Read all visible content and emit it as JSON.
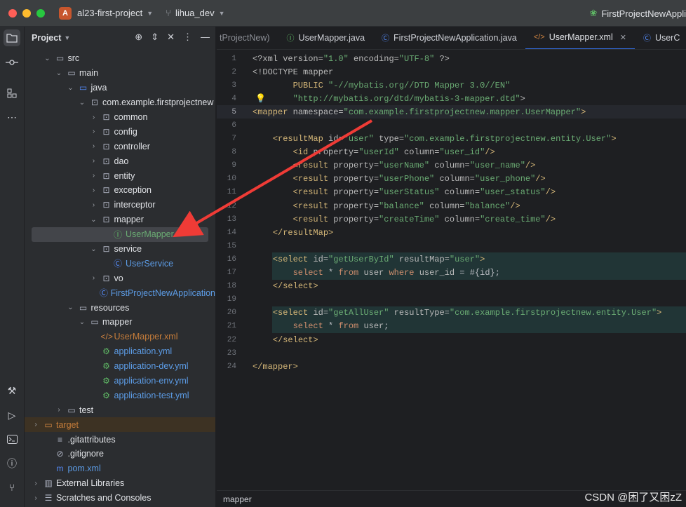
{
  "window": {
    "project_badge": "A",
    "project_name": "al23-first-project",
    "branch": "lihua_dev",
    "run_config": "FirstProjectNewAppli"
  },
  "project_panel": {
    "title": "Project",
    "tree": [
      {
        "label": "src",
        "type": "folder",
        "arrow": "open"
      },
      {
        "label": "main",
        "type": "folder",
        "arrow": "open"
      },
      {
        "label": "java",
        "type": "folder-src",
        "arrow": "open"
      },
      {
        "label": "com.example.firstprojectnew",
        "type": "package",
        "arrow": "open"
      },
      {
        "label": "common",
        "type": "package",
        "arrow": "closed"
      },
      {
        "label": "config",
        "type": "package",
        "arrow": "closed"
      },
      {
        "label": "controller",
        "type": "package",
        "arrow": "closed"
      },
      {
        "label": "dao",
        "type": "package",
        "arrow": "closed"
      },
      {
        "label": "entity",
        "type": "package",
        "arrow": "closed"
      },
      {
        "label": "exception",
        "type": "package",
        "arrow": "closed"
      },
      {
        "label": "interceptor",
        "type": "package",
        "arrow": "closed"
      },
      {
        "label": "mapper",
        "type": "package",
        "arrow": "open"
      },
      {
        "label": "UserMapper",
        "type": "interface",
        "arrow": "none",
        "selected": true
      },
      {
        "label": "service",
        "type": "package",
        "arrow": "open"
      },
      {
        "label": "UserService",
        "type": "class",
        "arrow": "none"
      },
      {
        "label": "vo",
        "type": "package",
        "arrow": "closed"
      },
      {
        "label": "FirstProjectNewApplication",
        "type": "spring-class",
        "arrow": "none"
      },
      {
        "label": "resources",
        "type": "folder-res",
        "arrow": "open"
      },
      {
        "label": "mapper",
        "type": "folder",
        "arrow": "open"
      },
      {
        "label": "UserMapper.xml",
        "type": "xml",
        "arrow": "none"
      },
      {
        "label": "application.yml",
        "type": "yml",
        "arrow": "none"
      },
      {
        "label": "application-dev.yml",
        "type": "yml",
        "arrow": "none"
      },
      {
        "label": "application-env.yml",
        "type": "yml",
        "arrow": "none"
      },
      {
        "label": "application-test.yml",
        "type": "yml",
        "arrow": "none"
      },
      {
        "label": "test",
        "type": "folder",
        "arrow": "closed"
      },
      {
        "label": "target",
        "type": "folder-excluded",
        "arrow": "closed"
      },
      {
        "label": ".gitattributes",
        "type": "text",
        "arrow": "none"
      },
      {
        "label": ".gitignore",
        "type": "ignore",
        "arrow": "none"
      },
      {
        "label": "pom.xml",
        "type": "maven",
        "arrow": "none"
      },
      {
        "label": "External Libraries",
        "type": "library",
        "arrow": "closed"
      },
      {
        "label": "Scratches and Consoles",
        "type": "scratch",
        "arrow": "closed"
      }
    ]
  },
  "tabs": [
    {
      "label": "tProjectNew)",
      "icon": "none"
    },
    {
      "label": "UserMapper.java",
      "icon": "interface-icon"
    },
    {
      "label": "FirstProjectNewApplication.java",
      "icon": "spring-class-icon"
    },
    {
      "label": "UserMapper.xml",
      "icon": "xml-icon",
      "active": true
    },
    {
      "label": "UserC",
      "icon": "class-icon"
    }
  ],
  "code_lines": [
    {
      "n": "1",
      "html": "<span class='a'>&lt;?xml version=</span><span class='s'>\"1.0\"</span><span class='a'> encoding=</span><span class='s'>\"UTF-8\"</span><span class='a'> ?&gt;</span>"
    },
    {
      "n": "2",
      "html": "<span class='a'>&lt;!DOCTYPE mapper</span>"
    },
    {
      "n": "3",
      "html": "        <span class='k'>PUBLIC</span> <span class='s'>\"-//mybatis.org//DTD Mapper 3.0//EN\"</span>"
    },
    {
      "n": "4",
      "html": "        <span class='s'>\"http://mybatis.org/dtd/mybatis-3-mapper.dtd\"</span><span class='a'>&gt;</span>"
    },
    {
      "n": "5",
      "html": "<span class='k'>&lt;mapper</span> <span class='a'>namespace=</span><span class='s'>\"com.example.firstprojectnew.mapper.UserMapper\"</span><span class='k'>&gt;</span>",
      "current": true
    },
    {
      "n": "6",
      "html": ""
    },
    {
      "n": "7",
      "html": "    <span class='k'>&lt;resultMap</span> <span class='a'>id=</span><span class='s'>\"user\"</span> <span class='a'>type=</span><span class='s'>\"com.example.firstprojectnew.entity.User\"</span><span class='k'>&gt;</span>"
    },
    {
      "n": "8",
      "html": "        <span class='k'>&lt;id</span> <span class='a'>property=</span><span class='s'>\"userId\"</span> <span class='a'>column=</span><span class='s'>\"user_id\"</span><span class='k'>/&gt;</span>"
    },
    {
      "n": "9",
      "html": "        <span class='k'>&lt;result</span> <span class='a'>property=</span><span class='s'>\"userName\"</span> <span class='a'>column=</span><span class='s'>\"user_name\"</span><span class='k'>/&gt;</span>"
    },
    {
      "n": "10",
      "html": "        <span class='k'>&lt;result</span> <span class='a'>property=</span><span class='s'>\"userPhone\"</span> <span class='a'>column=</span><span class='s'>\"user_phone\"</span><span class='k'>/&gt;</span>"
    },
    {
      "n": "11",
      "html": "        <span class='k'>&lt;result</span> <span class='a'>property=</span><span class='s'>\"userStatus\"</span> <span class='a'>column=</span><span class='s'>\"user_status\"</span><span class='k'>/&gt;</span>"
    },
    {
      "n": "12",
      "html": "        <span class='k'>&lt;result</span> <span class='a'>property=</span><span class='s'>\"balance\"</span> <span class='a'>column=</span><span class='s'>\"balance\"</span><span class='k'>/&gt;</span>"
    },
    {
      "n": "13",
      "html": "        <span class='k'>&lt;result</span> <span class='a'>property=</span><span class='s'>\"createTime\"</span> <span class='a'>column=</span><span class='s'>\"create_time\"</span><span class='k'>/&gt;</span>"
    },
    {
      "n": "14",
      "html": "    <span class='k'>&lt;/resultMap&gt;</span>"
    },
    {
      "n": "15",
      "html": ""
    },
    {
      "n": "16",
      "html": "    <span class='k'>&lt;select</span> <span class='a'>id=</span><span class='s'>\"getUserById\"</span> <span class='a'>resultMap=</span><span class='s'>\"user\"</span><span class='k'>&gt;</span>",
      "hl": true
    },
    {
      "n": "17",
      "html": "        <span class='p'>select</span> * <span class='p'>from</span> <span class='a'>user</span> <span class='p'>where</span> <span class='a'>user_id</span> = #{id};",
      "hl": true
    },
    {
      "n": "18",
      "html": "    <span class='k'>&lt;/select&gt;</span>"
    },
    {
      "n": "19",
      "html": ""
    },
    {
      "n": "20",
      "html": "    <span class='k'>&lt;select</span> <span class='a'>id=</span><span class='s'>\"getAllUser\"</span> <span class='a'>resultType=</span><span class='s'>\"com.example.firstprojectnew.entity.User\"</span><span class='k'>&gt;</span>",
      "hl": true
    },
    {
      "n": "21",
      "html": "        <span class='p'>select</span> * <span class='p'>from</span> <span class='a'>user</span>;",
      "hl": true
    },
    {
      "n": "22",
      "html": "    <span class='k'>&lt;/select&gt;</span>"
    },
    {
      "n": "23",
      "html": ""
    },
    {
      "n": "24",
      "html": "<span class='k'>&lt;/mapper&gt;</span>"
    }
  ],
  "breadcrumb": "mapper",
  "watermark": "CSDN @困了又困zZ"
}
